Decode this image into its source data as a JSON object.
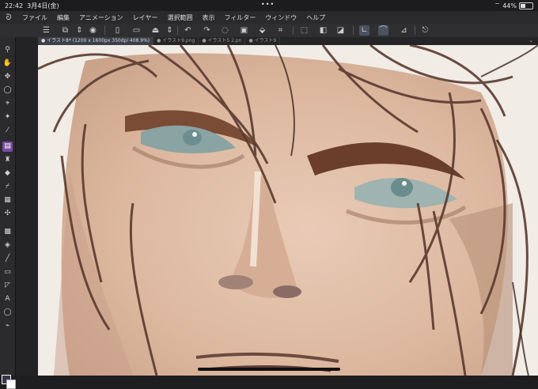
{
  "status": {
    "time": "22:42",
    "date": "3月4日(金)",
    "battery": "44%",
    "dots": "•••"
  },
  "menu": {
    "logo_icon": "clip-studio-logo-icon",
    "items": [
      "ファイル",
      "編集",
      "アニメーション",
      "レイヤー",
      "選択範囲",
      "表示",
      "フィルター",
      "ウィンドウ",
      "ヘルプ"
    ]
  },
  "tabs": [
    {
      "label": "イラスト8* (1200 x 1600px 350dpi 408.9%)",
      "active": true
    },
    {
      "label": "イラスト9.png",
      "active": false
    },
    {
      "label": "イラスト5 2.pn",
      "active": false
    },
    {
      "label": "イラスト9",
      "active": false
    }
  ],
  "toolbar_icons": [
    "menu-icon",
    "new-canvas-icon",
    "chevron-updown-icon",
    "visibility-icon",
    "new-file-icon",
    "open-folder-icon",
    "save-icon",
    "chevron-updown-icon",
    "undo-icon",
    "redo-icon",
    "clear-icon",
    "fill-icon",
    "transform-icon",
    "crop-icon",
    "deselect-icon",
    "invert-selection-icon",
    "snap-ruler-icon",
    "snap-special-icon",
    "snap-grid-icon",
    "quick-access-icon"
  ],
  "tools": [
    "view-icon",
    "hand-icon",
    "move-icon",
    "lasso-icon",
    "magic-wand-icon",
    "eyedropper-icon",
    "pen-icon",
    "brush-icon",
    "eraser-icon",
    "pencil-icon",
    "frame-icon",
    "decoration-icon",
    "gradient-icon",
    "fill-bucket-icon",
    "line-icon",
    "shape-icon",
    "ruler-icon",
    "text-icon",
    "balloon-icon",
    "correction-icon"
  ],
  "colors": {
    "main": "#3a3550",
    "sub": "#ffffff",
    "accent": "#4a5160",
    "active_tool": "#7a4aa0"
  }
}
